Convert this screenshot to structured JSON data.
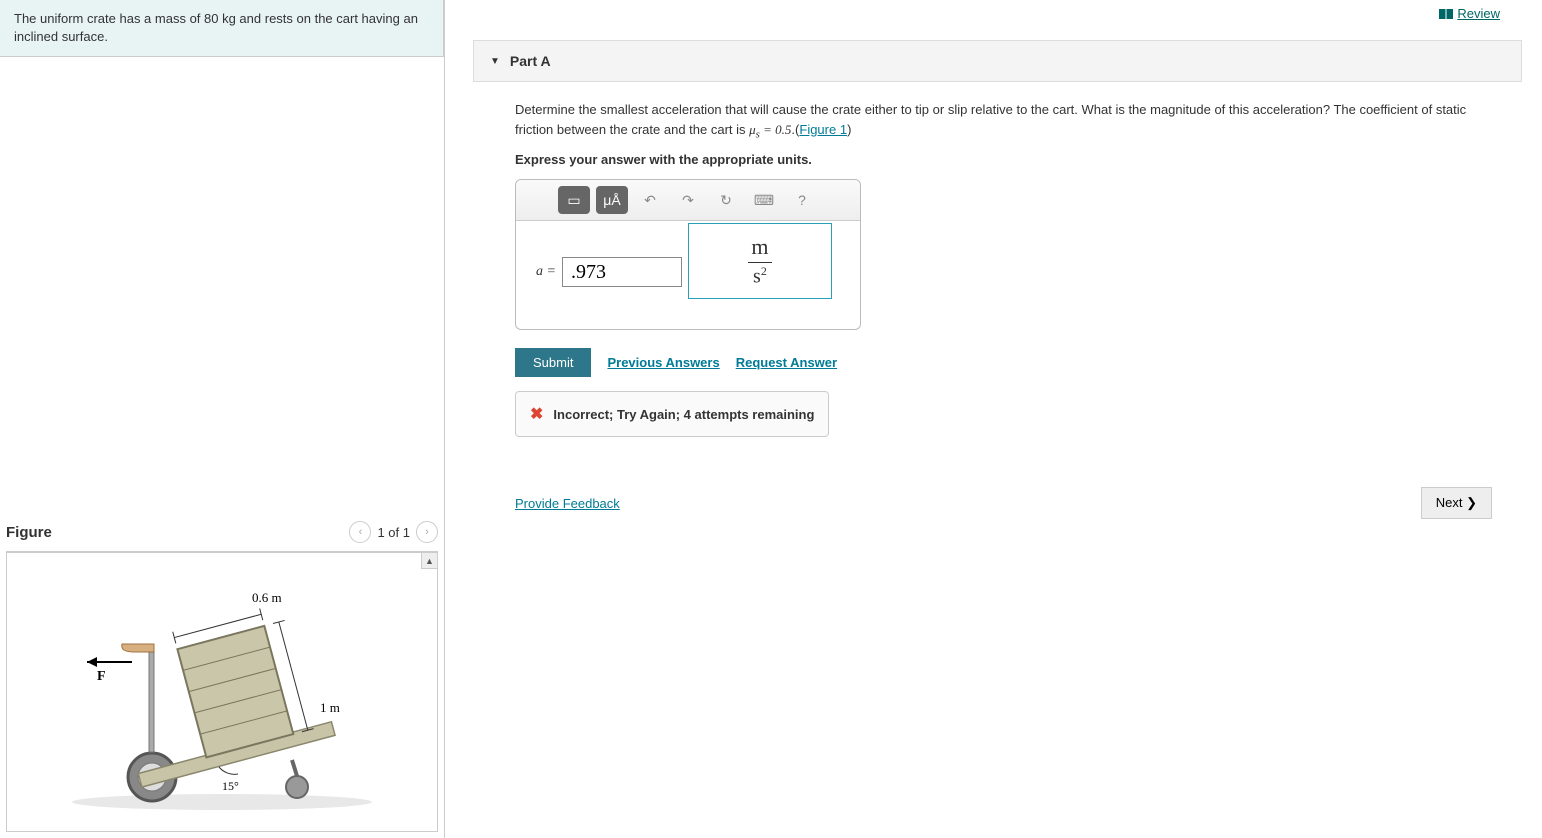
{
  "problem_statement": "The uniform crate has a mass of 80 kg and rests on the cart having an inclined surface.",
  "review_label": "Review",
  "part": {
    "label": "Part A",
    "question_pre": "Determine the smallest acceleration that will cause the crate either to tip or slip relative to the cart. What is the magnitude of this acceleration? The coefficient of static friction between the crate and the cart is ",
    "mu_expr": "μₛ = 0.5",
    "question_post": ".(",
    "figure_link_text": "Figure 1",
    "question_end": ")",
    "express": "Express your answer with the appropriate units."
  },
  "answer": {
    "variable": "a =",
    "value": ".973",
    "unit_num": "m",
    "unit_den": "s",
    "unit_exp": "2"
  },
  "toolbar": {
    "templates": "▭",
    "units": "μÅ",
    "undo": "↶",
    "redo": "↷",
    "reset": "↻",
    "keyboard": "⌨",
    "help": "?"
  },
  "actions": {
    "submit": "Submit",
    "previous_answers": "Previous Answers",
    "request_answer": "Request Answer"
  },
  "feedback": {
    "icon": "✖",
    "message": "Incorrect; Try Again; 4 attempts remaining"
  },
  "provide_feedback": "Provide Feedback",
  "next_label": "Next ❯",
  "figure": {
    "title": "Figure",
    "counter": "1 of 1",
    "width_label": "0.6 m",
    "height_label": "1 m",
    "angle_label": "15°",
    "force_label": "F"
  }
}
